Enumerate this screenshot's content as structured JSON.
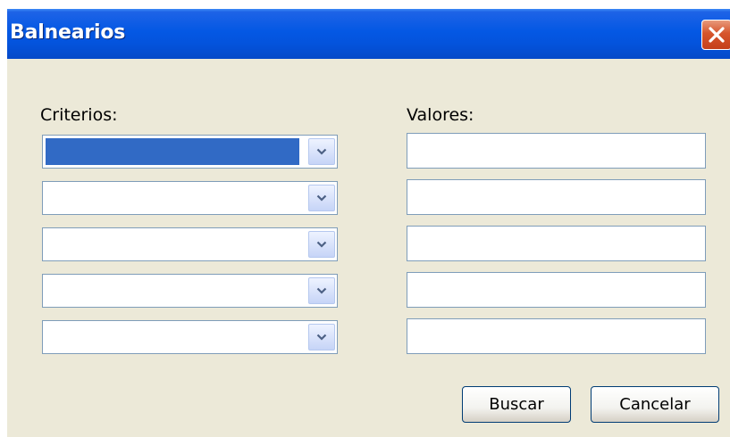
{
  "window": {
    "title": "Balnearios"
  },
  "form": {
    "criteria_label": "Criterios:",
    "values_label": "Valores:",
    "criteria": [
      {
        "selected": true,
        "value": ""
      },
      {
        "selected": false,
        "value": ""
      },
      {
        "selected": false,
        "value": ""
      },
      {
        "selected": false,
        "value": ""
      },
      {
        "selected": false,
        "value": ""
      }
    ],
    "values": [
      "",
      "",
      "",
      "",
      ""
    ]
  },
  "buttons": {
    "search_label": "Buscar",
    "cancel_label": "Cancelar"
  },
  "icons": {
    "close": "close-icon",
    "dropdown": "chevron-down-icon"
  },
  "colors": {
    "titlebar": "#0458e4",
    "window_bg": "#ece9d8",
    "selection": "#316ac5",
    "close_button": "#d6552c",
    "input_border": "#7f9db9"
  }
}
